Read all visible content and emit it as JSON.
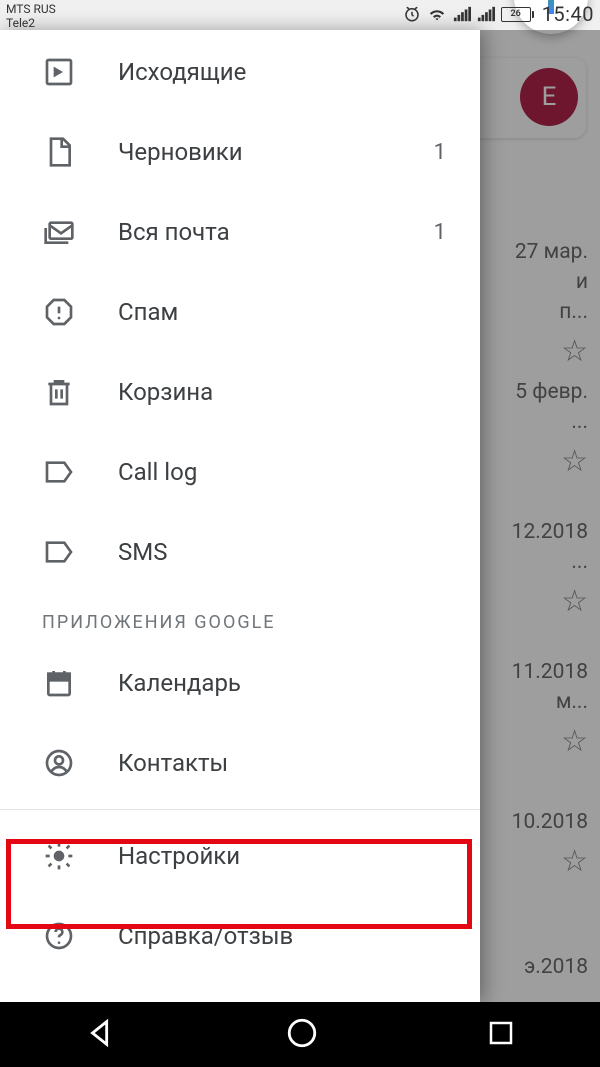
{
  "status": {
    "carrier1": "MTS RUS",
    "carrier2": "Tele2",
    "battery": "26",
    "time": "15:40"
  },
  "drawer": {
    "items": [
      {
        "label": "Исходящие",
        "count": "",
        "icon": "outbox"
      },
      {
        "label": "Черновики",
        "count": "1",
        "icon": "drafts"
      },
      {
        "label": "Вся почта",
        "count": "1",
        "icon": "allmail"
      },
      {
        "label": "Спам",
        "count": "",
        "icon": "spam"
      },
      {
        "label": "Корзина",
        "count": "",
        "icon": "trash"
      },
      {
        "label": "Call log",
        "count": "",
        "icon": "label"
      },
      {
        "label": "SMS",
        "count": "",
        "icon": "label"
      }
    ],
    "section_title": "ПРИЛОЖЕНИЯ GOOGLE",
    "google_apps": [
      {
        "label": "Календарь",
        "icon": "calendar"
      },
      {
        "label": "Контакты",
        "icon": "contacts"
      }
    ],
    "footer": [
      {
        "label": "Настройки",
        "icon": "settings"
      },
      {
        "label": "Справка/отзыв",
        "icon": "help"
      }
    ]
  },
  "background": {
    "avatar_letter": "E",
    "rows": [
      {
        "date": "27 мар.",
        "snip1": "и",
        "snip2": "п..."
      },
      {
        "date": "5 февр.",
        "snip1": "",
        "snip2": "..."
      },
      {
        "date": "12.2018",
        "snip1": "",
        "snip2": "..."
      },
      {
        "date": "11.2018",
        "snip1": "",
        "snip2": "м..."
      },
      {
        "date": "10.2018",
        "snip1": "",
        "snip2": ""
      },
      {
        "date": "э.2018",
        "snip1": "",
        "snip2": ""
      }
    ]
  }
}
